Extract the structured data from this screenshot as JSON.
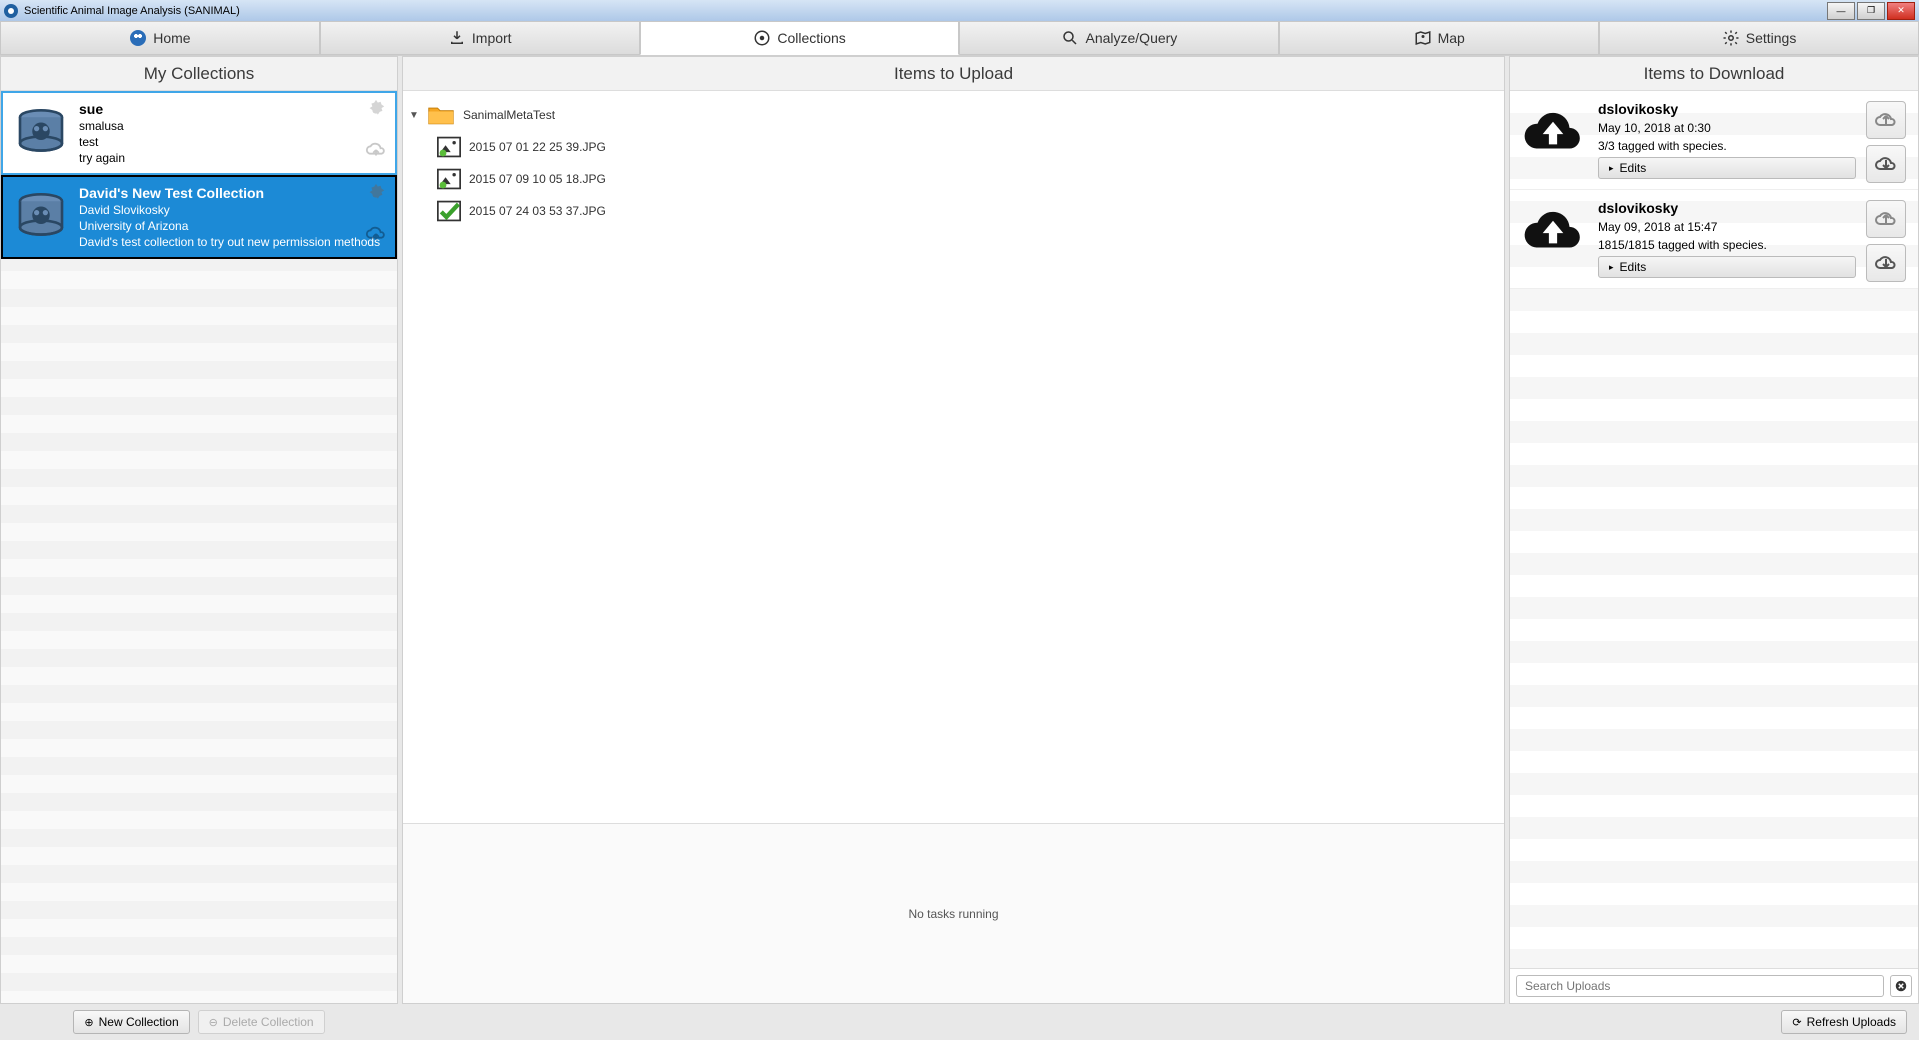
{
  "window": {
    "title": "Scientific Animal Image Analysis (SANIMAL)"
  },
  "tabs": [
    {
      "label": "Home"
    },
    {
      "label": "Import"
    },
    {
      "label": "Collections"
    },
    {
      "label": "Analyze/Query"
    },
    {
      "label": "Map"
    },
    {
      "label": "Settings"
    }
  ],
  "headers": {
    "left": "My Collections",
    "mid": "Items to Upload",
    "right": "Items to Download"
  },
  "collections": [
    {
      "title": "sue",
      "owner": "smalusa",
      "org": "test",
      "desc": "try again",
      "selected": false
    },
    {
      "title": "David's New Test Collection",
      "owner": "David Slovikosky",
      "org": "University of Arizona",
      "desc": "David's test collection to try out new permission methods",
      "selected": true
    }
  ],
  "tree": {
    "folder": "SanimalMetaTest",
    "files": [
      {
        "name": "2015 07 01 22 25 39.JPG",
        "checked": false
      },
      {
        "name": "2015 07 09 10 05 18.JPG",
        "checked": false
      },
      {
        "name": "2015 07 24 03 53 37.JPG",
        "checked": true
      }
    ]
  },
  "status": "No tasks running",
  "downloads": [
    {
      "user": "dslovikosky",
      "date": "May 10, 2018 at 0:30",
      "tagged": "3/3 tagged with species.",
      "edits": "Edits"
    },
    {
      "user": "dslovikosky",
      "date": "May 09, 2018 at 15:47",
      "tagged": "1815/1815 tagged with species.",
      "edits": "Edits"
    }
  ],
  "search": {
    "placeholder": "Search Uploads"
  },
  "buttons": {
    "newCollection": "New Collection",
    "deleteCollection": "Delete Collection",
    "refreshUploads": "Refresh Uploads"
  }
}
